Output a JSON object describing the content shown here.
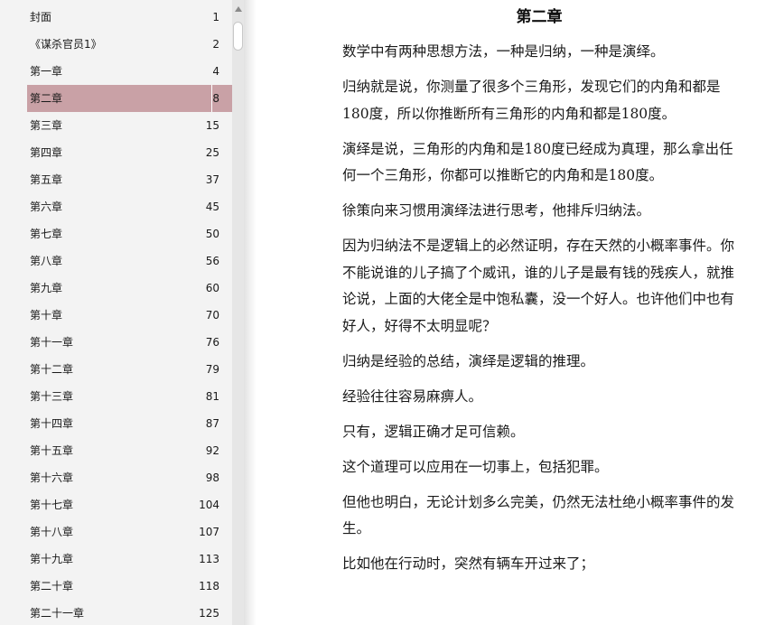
{
  "toc": {
    "items": [
      {
        "title": "封面",
        "page": "1"
      },
      {
        "title": "《谋杀官员1》",
        "page": "2"
      },
      {
        "title": "第一章",
        "page": "4"
      },
      {
        "title": "第二章",
        "page": "8"
      },
      {
        "title": "第三章",
        "page": "15"
      },
      {
        "title": "第四章",
        "page": "25"
      },
      {
        "title": "第五章",
        "page": "37"
      },
      {
        "title": "第六章",
        "page": "45"
      },
      {
        "title": "第七章",
        "page": "50"
      },
      {
        "title": "第八章",
        "page": "56"
      },
      {
        "title": "第九章",
        "page": "60"
      },
      {
        "title": "第十章",
        "page": "70"
      },
      {
        "title": "第十一章",
        "page": "76"
      },
      {
        "title": "第十二章",
        "page": "79"
      },
      {
        "title": "第十三章",
        "page": "81"
      },
      {
        "title": "第十四章",
        "page": "87"
      },
      {
        "title": "第十五章",
        "page": "92"
      },
      {
        "title": "第十六章",
        "page": "98"
      },
      {
        "title": "第十七章",
        "page": "104"
      },
      {
        "title": "第十八章",
        "page": "107"
      },
      {
        "title": "第十九章",
        "page": "113"
      },
      {
        "title": "第二十章",
        "page": "118"
      },
      {
        "title": "第二十一章",
        "page": "125"
      }
    ],
    "selected_index": 3
  },
  "colors": {
    "selected_bg": "#c9a1a6",
    "sidebar_bg": "#f3f3f3"
  },
  "scrollbar": {
    "up_arrow_icon": "triangle-up-icon"
  },
  "reader": {
    "chapter_title": "第二章",
    "paragraphs": [
      "数学中有两种思想方法，一种是归纳，一种是演绎。",
      "归纳就是说，你测量了很多个三角形，发现它们的内角和都是180度，所以你推断所有三角形的内角和都是180度。",
      "演绎是说，三角形的内角和是180度已经成为真理，那么拿出任何一个三角形，你都可以推断它的内角和是180度。",
      "徐策向来习惯用演绎法进行思考，他排斥归纳法。",
      "因为归纳法不是逻辑上的必然证明，存在天然的小概率事件。你不能说谁的儿子搞了个威讯，谁的儿子是最有钱的残疾人，就推论说，上面的大佬全是中饱私囊，没一个好人。也许他们中也有好人，好得不太明显呢？",
      "归纳是经验的总结，演绎是逻辑的推理。",
      "经验往往容易麻痹人。",
      "只有，逻辑正确才足可信赖。",
      "这个道理可以应用在一切事上，包括犯罪。",
      "但他也明白，无论计划多么完美，仍然无法杜绝小概率事件的发生。",
      "比如他在行动时，突然有辆车开过来了；"
    ]
  }
}
